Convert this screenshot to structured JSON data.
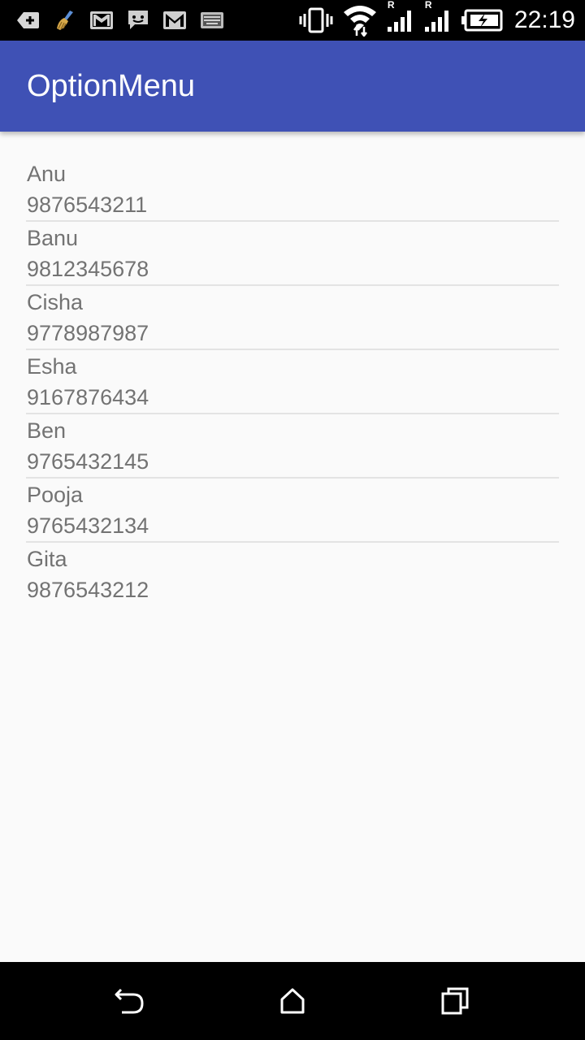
{
  "status_bar": {
    "time": "22:19",
    "left_icons": [
      "add-notification-icon",
      "cleaner-broom-icon",
      "gmail-icon",
      "chat-icon",
      "gmail-icon",
      "keyboard-icon"
    ],
    "right_icons": [
      "vibrate-icon",
      "wifi-icon",
      "signal-icon",
      "signal-icon",
      "battery-charging-icon"
    ],
    "roaming_label": "R"
  },
  "app_bar": {
    "title": "OptionMenu",
    "color": "#3f51b5"
  },
  "contacts": [
    {
      "name": "Anu",
      "phone": "9876543211"
    },
    {
      "name": "Banu",
      "phone": "9812345678"
    },
    {
      "name": "Cisha",
      "phone": "9778987987"
    },
    {
      "name": "Esha",
      "phone": "9167876434"
    },
    {
      "name": "Ben",
      "phone": "9765432145"
    },
    {
      "name": "Pooja",
      "phone": "9765432134"
    },
    {
      "name": "Gita",
      "phone": "9876543212"
    }
  ],
  "nav_bar": {
    "buttons": [
      "back-icon",
      "home-icon",
      "recents-icon"
    ]
  }
}
